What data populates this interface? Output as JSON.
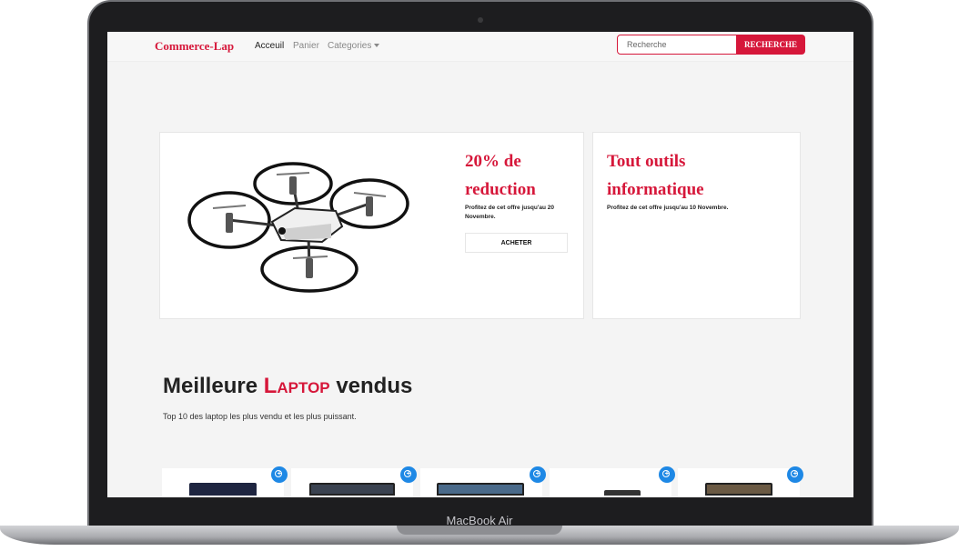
{
  "device": {
    "label": "MacBook Air"
  },
  "navbar": {
    "brand": "Commerce-Lap",
    "links": [
      "Acceuil",
      "Panier"
    ],
    "categories_label": "Categories",
    "search_placeholder": "Recherche",
    "search_button": "RECHERCHE"
  },
  "promos": [
    {
      "title_line1": "20% de",
      "title_line2": "reduction",
      "subtitle": "Profitez de cet offre jusqu'au 20 Novembre.",
      "button": "ACHETER"
    },
    {
      "title_line1": "Tout outils",
      "title_line2": "informatique",
      "subtitle": "Profitez de cet offre jusqu'au 10 Novembre."
    }
  ],
  "section": {
    "title_before": "Meilleure",
    "title_highlight": "Laptop",
    "title_after": "vendus",
    "subtitle": "Top 10 des laptop les plus vendu et les plus puissant."
  },
  "products_visible": 5,
  "colors": {
    "accent": "#d6173a",
    "add_button": "#1e88e5",
    "page_bg": "#f4f4f4"
  },
  "icons": [
    "drone-image",
    "caret-down-icon",
    "add-circle-icon",
    "laptop-thumbnail"
  ]
}
